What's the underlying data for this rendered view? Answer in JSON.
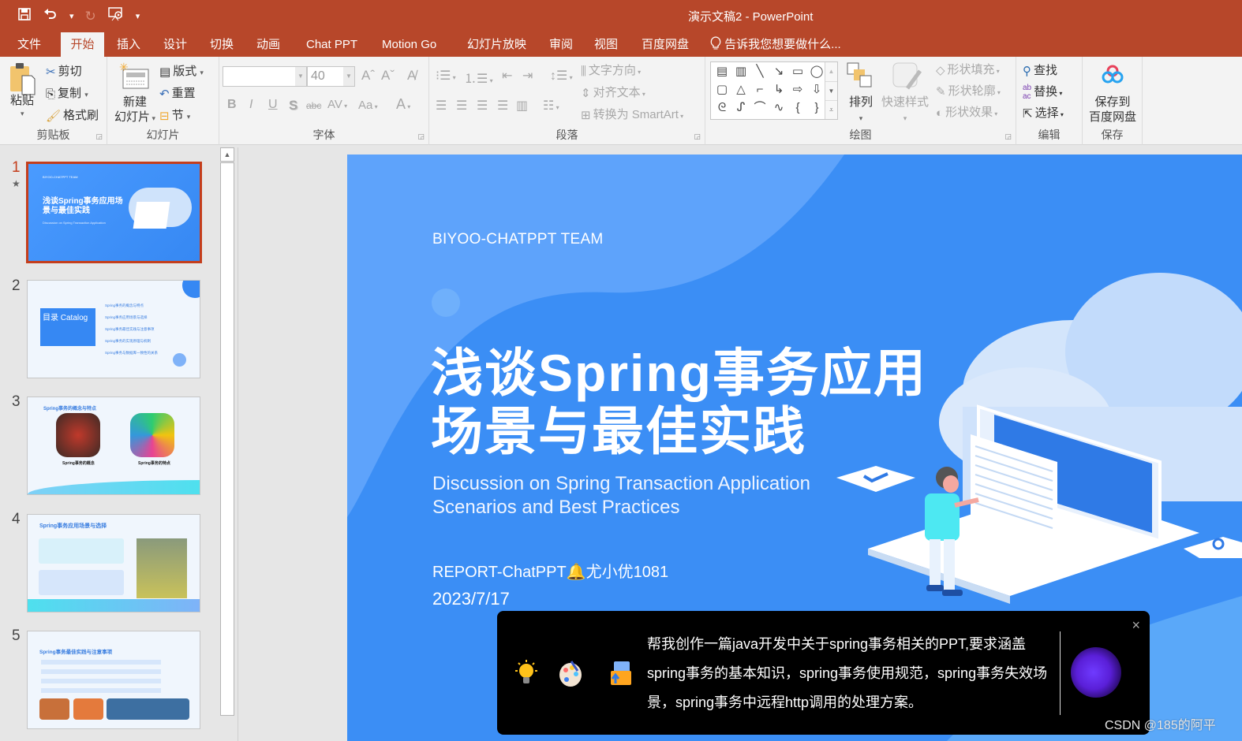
{
  "window": {
    "title": "演示文稿2 - PowerPoint",
    "qat": {
      "save_icon": "save-icon",
      "undo_icon": "undo-icon",
      "redo_icon": "redo-icon",
      "present_icon": "start-slideshow-icon",
      "customize_icon": "customize-qat-icon"
    }
  },
  "tabs": [
    {
      "label": "文件",
      "active": false
    },
    {
      "label": "开始",
      "active": true
    },
    {
      "label": "插入",
      "active": false
    },
    {
      "label": "设计",
      "active": false
    },
    {
      "label": "切换",
      "active": false
    },
    {
      "label": "动画",
      "active": false
    },
    {
      "label": "Chat PPT",
      "active": false
    },
    {
      "label": "Motion Go",
      "active": false
    },
    {
      "label": "幻灯片放映",
      "active": false
    },
    {
      "label": "审阅",
      "active": false
    },
    {
      "label": "视图",
      "active": false
    },
    {
      "label": "百度网盘",
      "active": false
    }
  ],
  "tell_me": "告诉我您想要做什么...",
  "ribbon": {
    "clipboard": {
      "label": "剪贴板",
      "paste": "粘贴",
      "cut": "剪切",
      "copy": "复制",
      "format_painter": "格式刷"
    },
    "slides": {
      "label": "幻灯片",
      "new_slide_line1": "新建",
      "new_slide_line2": "幻灯片",
      "layout": "版式",
      "reset": "重置",
      "section": "节"
    },
    "font": {
      "label": "字体",
      "font_name": "",
      "font_size": "40",
      "bold": "B",
      "italic": "I",
      "underline": "U",
      "shadow": "S",
      "strike": "abc",
      "spacing": "AV",
      "case": "Aa",
      "color": "A",
      "grow": "Aˆ",
      "shrink": "Aˇ"
    },
    "paragraph": {
      "label": "段落",
      "text_direction": "文字方向",
      "align_text": "对齐文本",
      "smartart": "转换为 SmartArt"
    },
    "drawing": {
      "label": "绘图",
      "arrange": "排列",
      "quick_styles": "快速样式",
      "shape_fill": "形状填充",
      "shape_outline": "形状轮廓",
      "shape_effects": "形状效果"
    },
    "editing": {
      "label": "编辑",
      "find": "查找",
      "replace": "替换",
      "select": "选择"
    },
    "save": {
      "label": "保存",
      "save_to_line1": "保存到",
      "save_to_line2": "百度网盘"
    }
  },
  "slides": [
    {
      "number": "1",
      "has_animation": true,
      "selected": true,
      "title": "浅谈Spring事务应用场景与最佳实践"
    },
    {
      "number": "2",
      "selected": false,
      "title": "目录 Catalog",
      "items": [
        "Spring事务的概念与特点",
        "Spring事务应用场景与选择",
        "Spring事务最佳实践与注意事项",
        "Spring事务的实现原理与机制",
        "Spring事务与数据库一致性的关系"
      ]
    },
    {
      "number": "3",
      "selected": false,
      "title": "Spring事务的概念与特点",
      "cols": [
        "Spring事务的概念",
        "Spring事务的特点"
      ]
    },
    {
      "number": "4",
      "selected": false,
      "title": "Spring事务应用场景与选择"
    },
    {
      "number": "5",
      "selected": false,
      "title": "Spring事务最佳实践与注意事项"
    }
  ],
  "current_slide": {
    "team": "BIYOO-CHATPPT TEAM",
    "title_line1": "浅谈Spring事务应用",
    "title_line2": "场景与最佳实践",
    "subtitle_line1": "Discussion on Spring Transaction Application",
    "subtitle_line2": "Scenarios and Best Practices",
    "report": "REPORT-ChatPPT🔔尤小优1081",
    "date": "2023/7/17"
  },
  "chatppt_popup": {
    "prompt": "帮我创作一篇java开发中关于spring事务相关的PPT,要求涵盖spring事务的基本知识，spring事务使用规范，spring事务失效场景，spring事务中远程http调用的处理方案。",
    "close_label": "×"
  },
  "watermark": "CSDN @185的阿平",
  "colors": {
    "accent": "#b7472a",
    "slide_bg": "#3b8ef5",
    "selected_border": "#c43e1c"
  }
}
